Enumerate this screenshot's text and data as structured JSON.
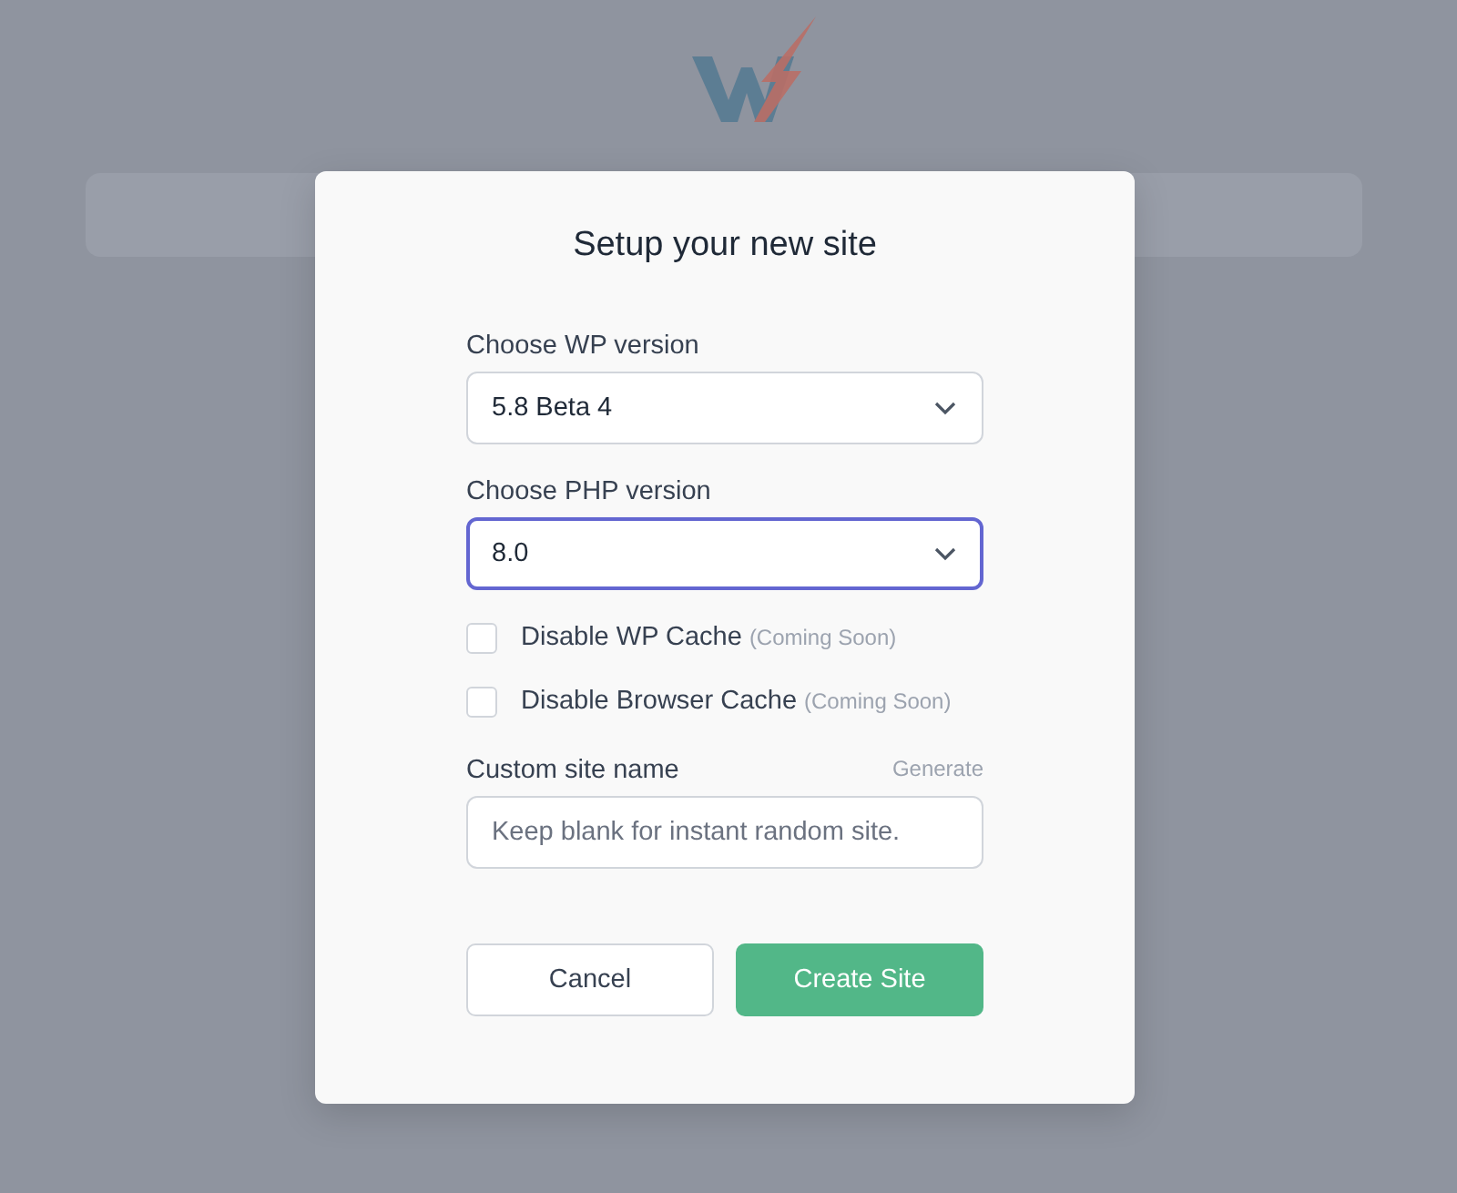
{
  "dialog": {
    "title": "Setup your new site",
    "selects": [
      {
        "label": "Choose WP version",
        "value": "5.8 Beta 4",
        "focused": false
      },
      {
        "label": "Choose PHP version",
        "value": "8.0",
        "focused": true
      }
    ],
    "checkboxes": [
      {
        "label": "Disable WP Cache",
        "note": "(Coming Soon)",
        "checked": false
      },
      {
        "label": "Disable Browser Cache",
        "note": "(Coming Soon)",
        "checked": false
      }
    ],
    "site_name": {
      "label": "Custom site name",
      "link": "Generate",
      "placeholder": "Keep blank for instant random site."
    },
    "buttons": [
      {
        "label": "Cancel",
        "kind": "secondary"
      },
      {
        "label": "Create Site",
        "kind": "primary"
      }
    ]
  }
}
